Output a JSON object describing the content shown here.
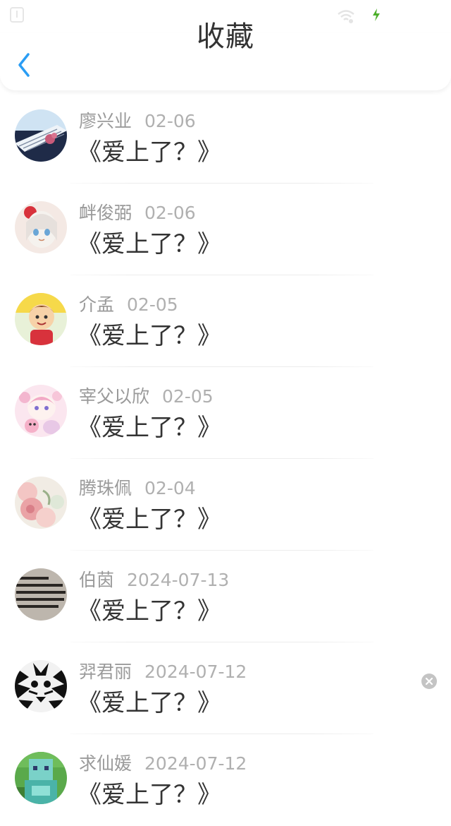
{
  "header": {
    "title": "收藏",
    "accent_color": "#2a9df4"
  },
  "items": [
    {
      "name": "廖兴业",
      "date": "02-06",
      "title": "《爱上了？》",
      "avatar": "piano-avatar"
    },
    {
      "name": "衅俊弼",
      "date": "02-06",
      "title": "《爱上了？》",
      "avatar": "anime-girl-avatar"
    },
    {
      "name": "介孟",
      "date": "02-05",
      "title": "《爱上了？》",
      "avatar": "cartoon-kid-avatar"
    },
    {
      "name": "宰父以欣",
      "date": "02-05",
      "title": "《爱上了？》",
      "avatar": "pink-anime-avatar"
    },
    {
      "name": "腾珠佩",
      "date": "02-04",
      "title": "《爱上了？》",
      "avatar": "flowers-avatar"
    },
    {
      "name": "伯茵",
      "date": "2024-07-13",
      "title": "《爱上了？》",
      "avatar": "text-photo-avatar"
    },
    {
      "name": "羿君丽",
      "date": "2024-07-12",
      "title": "《爱上了？》",
      "avatar": "tiger-avatar"
    },
    {
      "name": "求仙媛",
      "date": "2024-07-12",
      "title": "《爱上了？》",
      "avatar": "minecraft-avatar"
    }
  ]
}
